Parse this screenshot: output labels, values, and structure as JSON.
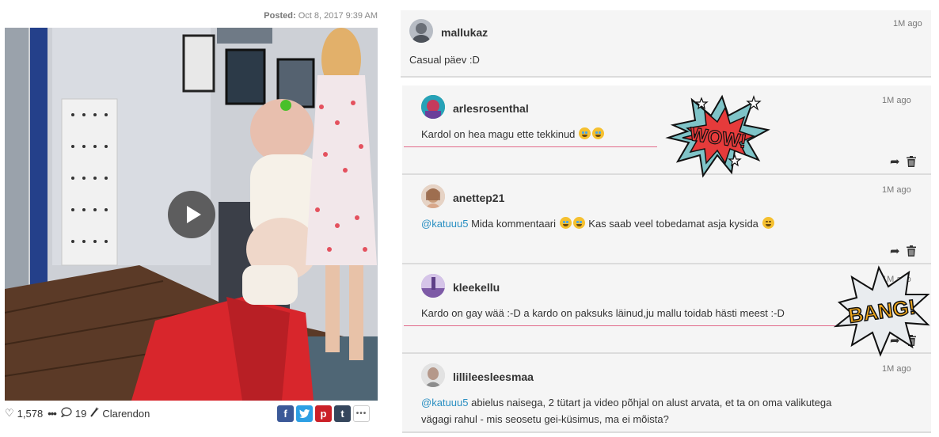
{
  "post": {
    "posted_label": "Posted:",
    "posted_date": "Oct 8, 2017 9:39 AM",
    "likes": "1,578",
    "comments_count": "19",
    "filter": "Clarendon",
    "share": {
      "facebook": "f",
      "twitter": "t",
      "pinterest": "p",
      "tumblr": "t"
    }
  },
  "comments": [
    {
      "user": "mallukaz",
      "time": "1M ago",
      "text": "Casual päev :D"
    },
    {
      "user": "arlesrosenthal",
      "time": "1M ago",
      "text": "Kardol on hea magu ette tekkinud"
    },
    {
      "user": "anettep21",
      "time": "1M ago",
      "mention": "@katuuu5",
      "text": "Mida kommentaari",
      "text2": "Kas saab veel tobedamat asja kysida"
    },
    {
      "user": "kleekellu",
      "time": "1M ago",
      "text": "Kardo on gay wää :-D a kardo on paksuks läinud,ju mallu toidab hästi meest :-D"
    },
    {
      "user": "lillileesleesmaa",
      "time": "1M ago",
      "mention": "@katuuu5",
      "text": "abielus naisega, 2 tütart ja video põhjal on alust arvata, et ta on oma valikutega",
      "text2": "vägagi rahul - mis seosetu gei-küsimus, ma ei mõista?"
    }
  ],
  "stickers": {
    "wow": "WOW!",
    "bang": "BANG!"
  },
  "colors": {
    "mention": "#2a8fc2",
    "underline": "#e26a8a",
    "card": "#f5f5f5"
  }
}
